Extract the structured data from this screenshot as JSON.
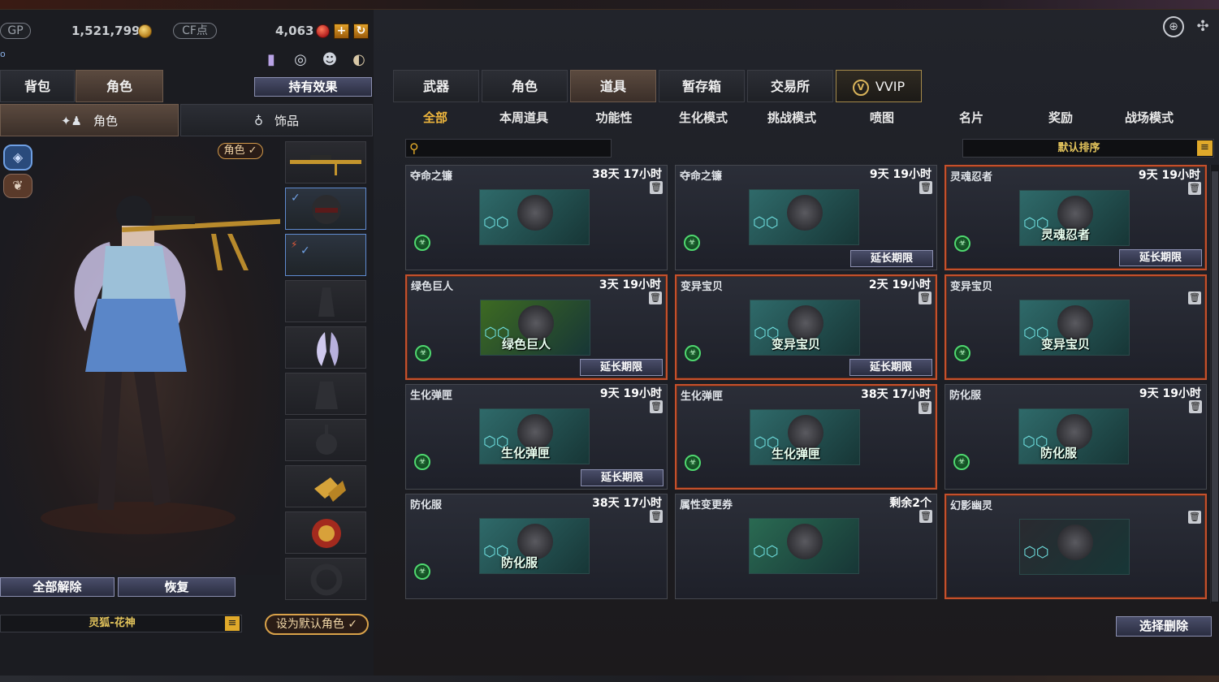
{
  "currency": {
    "gp_label": "GP",
    "gp_value": "1,521,799",
    "cf_label": "CF点",
    "cf_value": "4,063",
    "plus_label": "+"
  },
  "left": {
    "tabs": [
      {
        "label": "背包",
        "active": false
      },
      {
        "label": "角色",
        "active": true
      }
    ],
    "effects_button": "持有效果",
    "subtabs": [
      {
        "label": "角色",
        "active": true
      },
      {
        "label": "饰品",
        "active": false
      }
    ],
    "role_badge": "角色 ✓",
    "unequip_all": "全部解除",
    "restore": "恢复",
    "character_name": "灵狐-花神",
    "set_default": "设为默认角色"
  },
  "main": {
    "tabs": [
      {
        "label": "武器",
        "active": false
      },
      {
        "label": "角色",
        "active": false
      },
      {
        "label": "道具",
        "active": true
      },
      {
        "label": "暂存箱",
        "active": false
      },
      {
        "label": "交易所",
        "active": false
      },
      {
        "label": "VVIP",
        "active": false
      }
    ],
    "filters": [
      {
        "label": "全部",
        "active": true
      },
      {
        "label": "本周道具",
        "active": false
      },
      {
        "label": "功能性",
        "active": false
      },
      {
        "label": "生化模式",
        "active": false
      },
      {
        "label": "挑战模式",
        "active": false
      },
      {
        "label": "喷图",
        "active": false
      },
      {
        "label": "名片",
        "active": false
      },
      {
        "label": "奖励",
        "active": false
      },
      {
        "label": "战场模式",
        "active": false
      }
    ],
    "search_placeholder": "",
    "sort_label": "默认排序",
    "extend_label": "延长期限",
    "batch_delete": "选择删除",
    "items": [
      {
        "name": "夺命之镰",
        "time": "38天 17小时",
        "img_label": "",
        "extend": false,
        "highlight": false,
        "color": "#2f6a6a"
      },
      {
        "name": "夺命之镰",
        "time": "9天 19小时",
        "img_label": "",
        "extend": true,
        "highlight": false,
        "color": "#2f6a6a"
      },
      {
        "name": "灵魂忍者",
        "time": "9天 19小时",
        "img_label": "灵魂忍者",
        "extend": true,
        "highlight": true,
        "color": "#2f6a6a"
      },
      {
        "name": "绿色巨人",
        "time": "3天 19小时",
        "img_label": "绿色巨人",
        "extend": true,
        "highlight": true,
        "color": "#3d6a22"
      },
      {
        "name": "变异宝贝",
        "time": "2天 19小时",
        "img_label": "变异宝贝",
        "extend": true,
        "highlight": true,
        "color": "#2f6a6a"
      },
      {
        "name": "变异宝贝",
        "time": "",
        "img_label": "变异宝贝",
        "extend": false,
        "highlight": true,
        "color": "#2f6a6a"
      },
      {
        "name": "生化弹匣",
        "time": "9天 19小时",
        "img_label": "生化弹匣",
        "extend": true,
        "highlight": false,
        "color": "#2f6a6a"
      },
      {
        "name": "生化弹匣",
        "time": "38天 17小时",
        "img_label": "生化弹匣",
        "extend": false,
        "highlight": true,
        "color": "#2f6a6a"
      },
      {
        "name": "防化服",
        "time": "9天 19小时",
        "img_label": "防化服",
        "extend": false,
        "highlight": false,
        "color": "#2f6a6a"
      },
      {
        "name": "防化服",
        "time": "38天 17小时",
        "img_label": "防化服",
        "extend": false,
        "highlight": false,
        "color": "#2f6a6a"
      },
      {
        "name": "属性变更券",
        "time": "剩余2个",
        "img_label": "",
        "extend": false,
        "highlight": false,
        "color": "#2a6a52"
      },
      {
        "name": "幻影幽灵",
        "time": "",
        "img_label": "",
        "extend": false,
        "highlight": true,
        "color": "#2a2a30"
      }
    ]
  }
}
